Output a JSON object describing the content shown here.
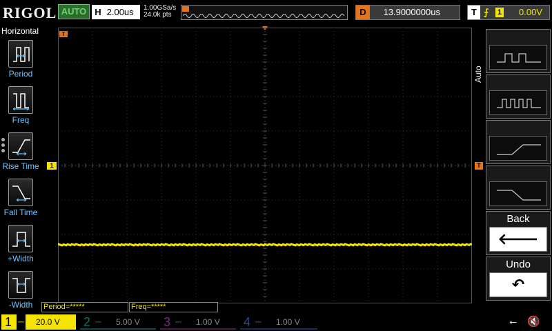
{
  "brand": "RIGOL",
  "run_mode": "AUTO",
  "horizontal": {
    "letter": "H",
    "timebase": "2.00us",
    "sample_rate": "1.00GSa/s",
    "mem_depth": "24.0k pts"
  },
  "delay": {
    "letter": "D",
    "value": "13.9000000us"
  },
  "trigger": {
    "letter": "T",
    "edge": "⨍",
    "source": "1",
    "level": "0.00V"
  },
  "left_menu": {
    "title": "Horizontal",
    "items": [
      {
        "label": "Period",
        "icon": "period-icon"
      },
      {
        "label": "Freq",
        "icon": "freq-icon"
      },
      {
        "label": "Rise Time",
        "icon": "rise-time-icon"
      },
      {
        "label": "Fall Time",
        "icon": "fall-time-icon"
      },
      {
        "label": "+Width",
        "icon": "pos-width-icon"
      },
      {
        "label": "-Width",
        "icon": "neg-width-icon"
      }
    ]
  },
  "right_menu": {
    "tab_label": "Auto",
    "buttons": [
      {
        "icon": "square-wave-icon"
      },
      {
        "icon": "pulse-train-icon"
      },
      {
        "icon": "rising-edge-icon"
      },
      {
        "icon": "falling-edge-icon"
      }
    ],
    "back_label": "Back",
    "back_icon": "🡐",
    "undo_label": "Undo",
    "undo_icon": "↶"
  },
  "markers": {
    "ch1": "1",
    "trigger_marker": "T"
  },
  "measurements": {
    "period": "Period=*****",
    "freq": "Freq=*****"
  },
  "channels": [
    {
      "num": "1",
      "coupling": "⎓",
      "scale": "20.0 V",
      "color": "#f5e400",
      "active": true
    },
    {
      "num": "2",
      "coupling": "⎓",
      "scale": "5.00 V",
      "color": "#19c8c8",
      "active": false
    },
    {
      "num": "3",
      "coupling": "⎓",
      "scale": "1.00 V",
      "color": "#e052e0",
      "active": false
    },
    {
      "num": "4",
      "coupling": "⎓",
      "scale": "1.00 V",
      "color": "#2a7fff",
      "active": false
    }
  ],
  "status_icons": {
    "usb": "⭠",
    "speaker": "🔇"
  },
  "colors": {
    "trace": "#f5e400",
    "accent": "#e4731a",
    "grid": "#3a3a3a",
    "menu_text": "#6cc4ff"
  }
}
